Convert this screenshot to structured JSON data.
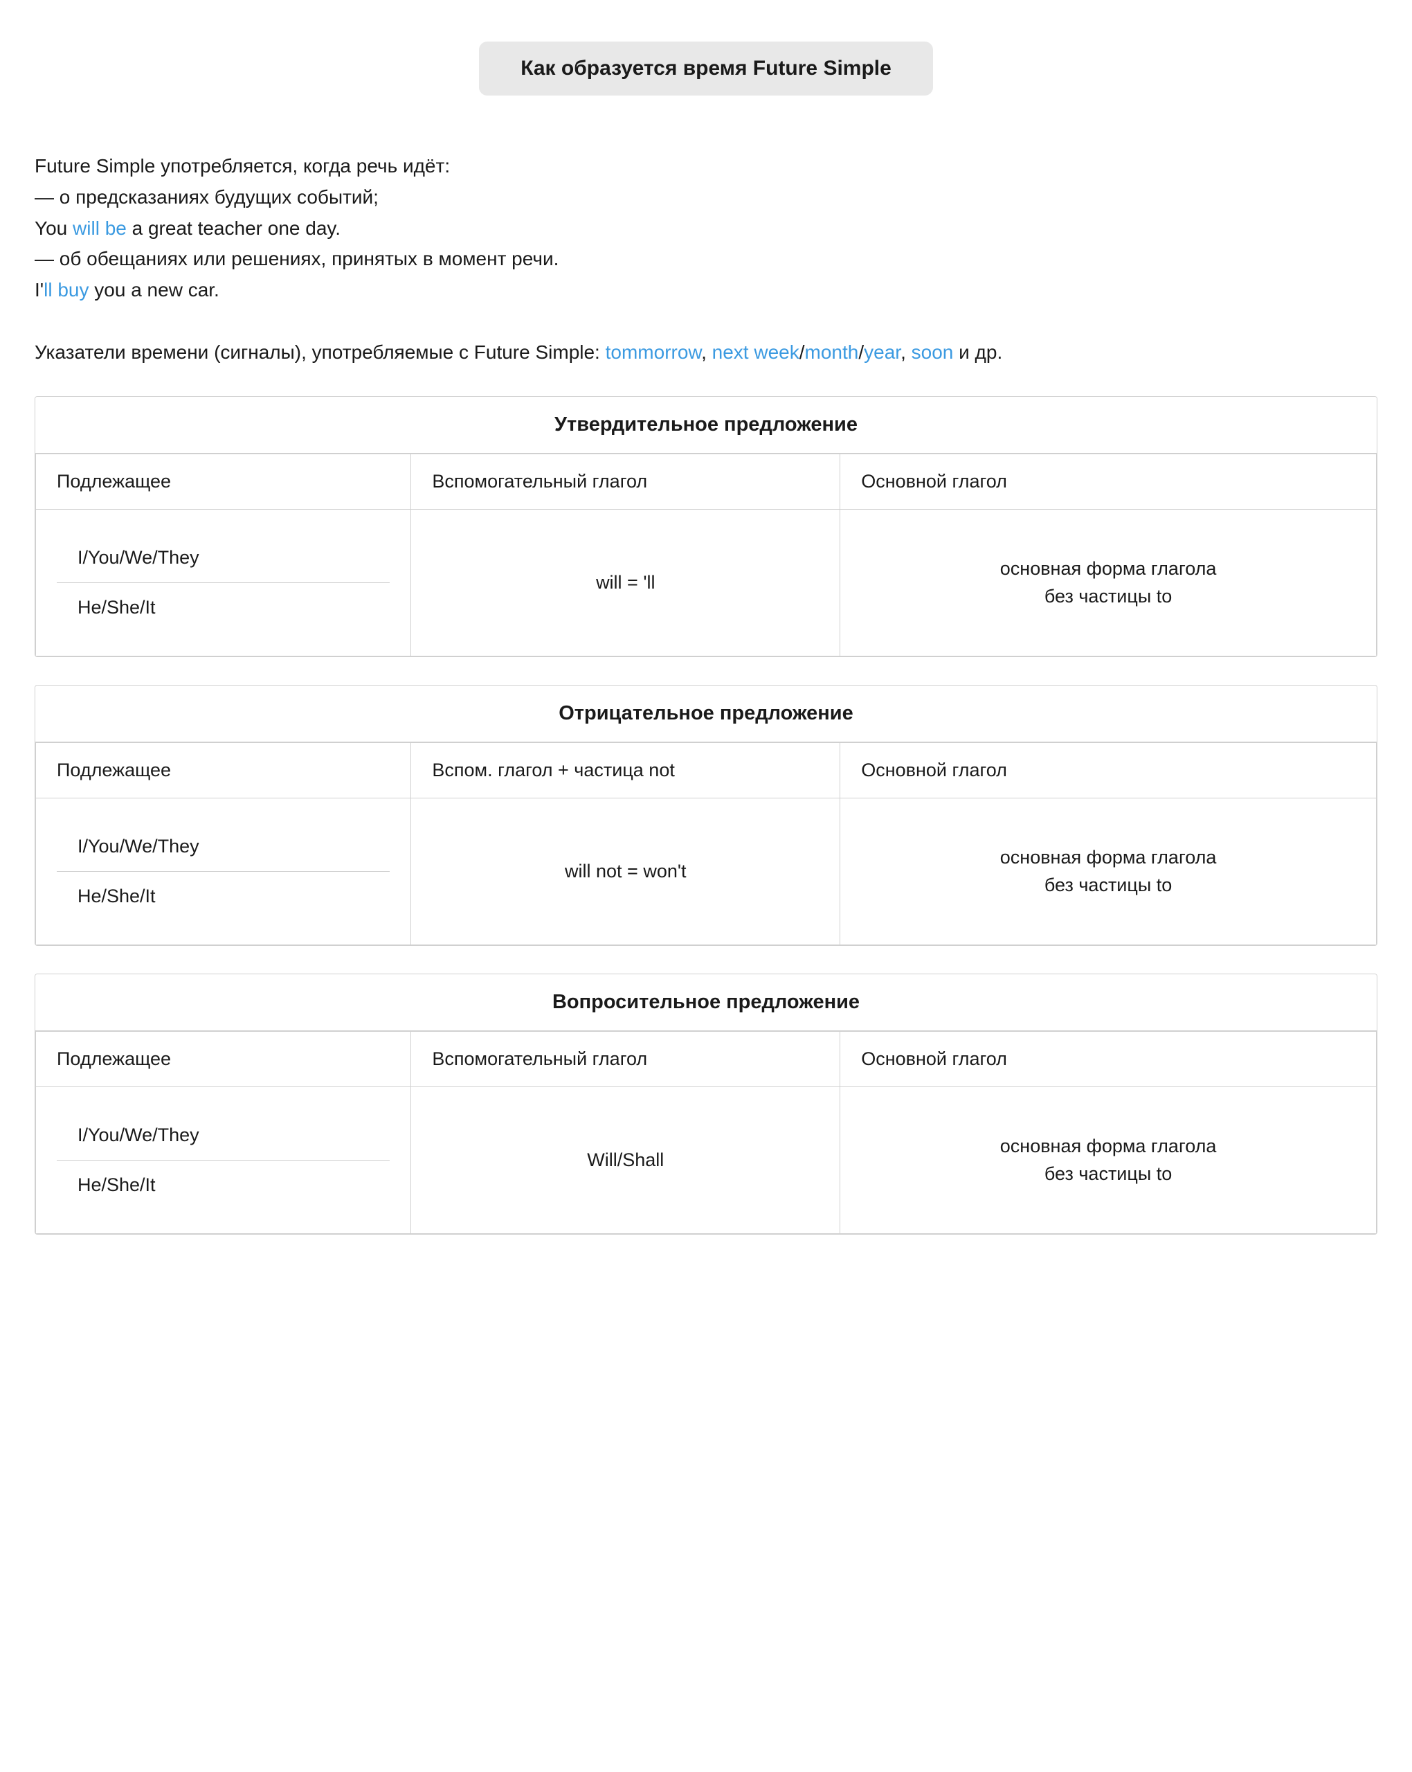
{
  "title": "Как образуется время Future Simple",
  "intro": {
    "line1": "Future Simple употребляется, когда речь идёт:",
    "line2": "— о предсказаниях будущих событий;",
    "line3_pre": "You ",
    "line3_highlight": "will be",
    "line3_post": " a great teacher one day.",
    "line4": "— об обещаниях или решениях, принятых в момент речи.",
    "line5_pre": "I'",
    "line5_highlight": "ll buy",
    "line5_post": " you a new car.",
    "line6_pre": "Указатели времени (сигналы), употребляемые с Future Simple: ",
    "signals": [
      {
        "text": "tommorrow",
        "highlight": true
      },
      {
        "text": ", "
      },
      {
        "text": "next week",
        "highlight": true
      },
      {
        "text": "/",
        "highlight": false
      },
      {
        "text": "month",
        "highlight": true
      },
      {
        "text": "/",
        "highlight": false
      },
      {
        "text": "year",
        "highlight": true
      },
      {
        "text": ", "
      },
      {
        "text": "soon",
        "highlight": true
      },
      {
        "text": " и др."
      }
    ]
  },
  "affirmative": {
    "header": "Утвердительное предложение",
    "columns": [
      "Подлежащее",
      "Вспомогательный глагол",
      "Основной глагол"
    ],
    "subject_top": "I/You/We/They",
    "subject_bottom": "He/She/It",
    "aux": "will = 'll",
    "main_line1": "основная форма глагола",
    "main_line2": "без частицы to"
  },
  "negative": {
    "header": "Отрицательное предложение",
    "columns": [
      "Подлежащее",
      "Вспом. глагол + частица not",
      "Основной глагол"
    ],
    "subject_top": "I/You/We/They",
    "subject_bottom": "He/She/It",
    "aux": "will not = won't",
    "main_line1": "основная форма глагола",
    "main_line2": "без частицы to"
  },
  "interrogative": {
    "header": "Вопросительное предложение",
    "columns": [
      "Подлежащее",
      "Вспомогательный глагол",
      "Основной глагол"
    ],
    "subject_top": "I/You/We/They",
    "subject_bottom": "He/She/It",
    "aux": "Will/Shall",
    "main_line1": "основная форма глагола",
    "main_line2": "без частицы to"
  }
}
